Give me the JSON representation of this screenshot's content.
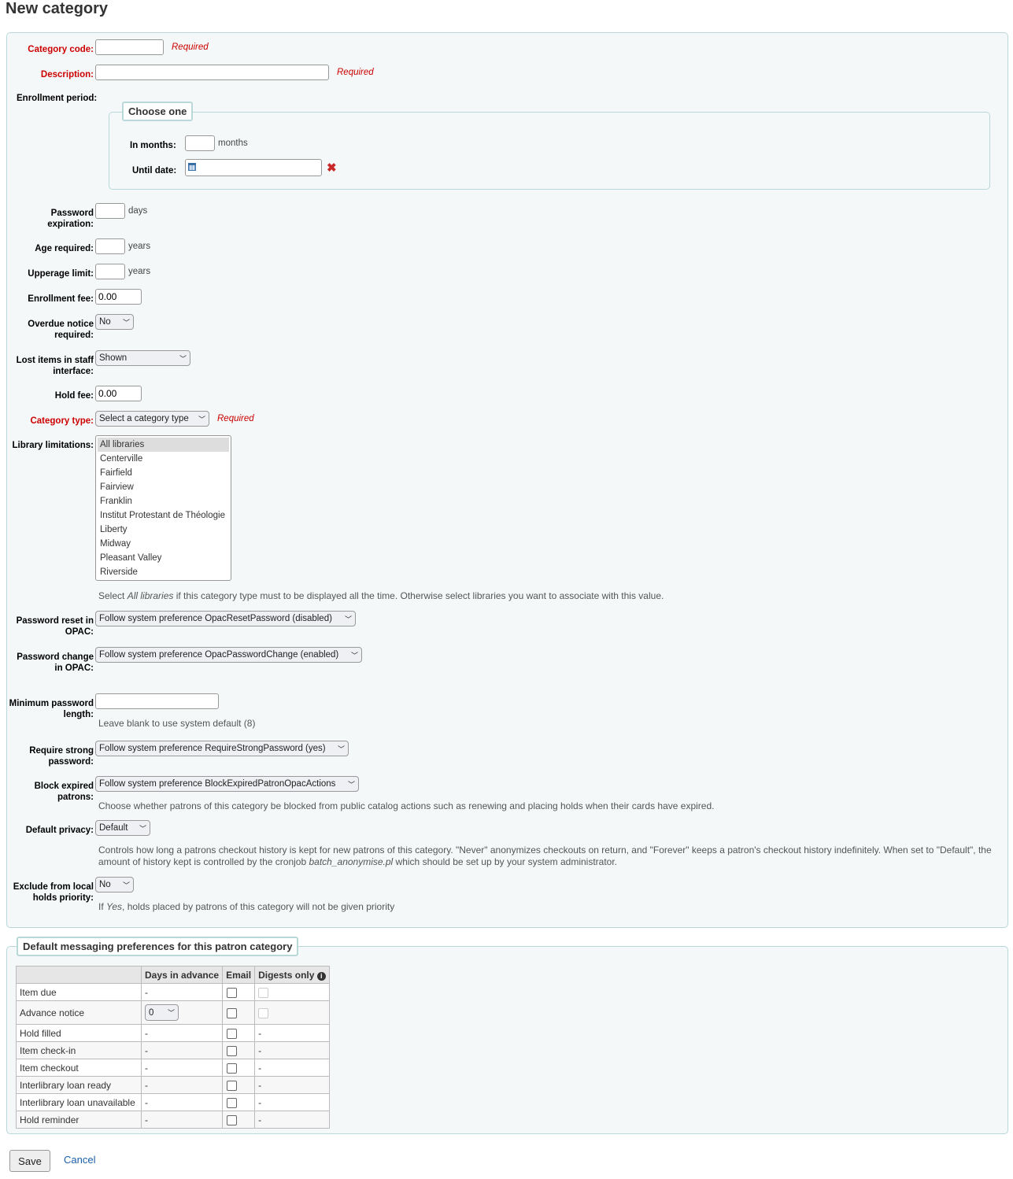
{
  "page_title": "New category",
  "form": {
    "category_code": {
      "label": "Category code:",
      "value": "",
      "required": "Required"
    },
    "description": {
      "label": "Description:",
      "value": "",
      "required": "Required"
    },
    "enrollment_period": {
      "label": "Enrollment period:",
      "legend": "Choose one",
      "in_months_label": "In months:",
      "in_months_unit": "months",
      "until_date_label": "Until date:",
      "calendar_icon": "calendar-icon",
      "clear_icon": "close-x-icon"
    },
    "password_expiration": {
      "label": "Password expiration:",
      "unit": "days"
    },
    "age_required": {
      "label": "Age required:",
      "unit": "years"
    },
    "upperage_limit": {
      "label": "Upperage limit:",
      "unit": "years"
    },
    "enrollment_fee": {
      "label": "Enrollment fee:",
      "value": "0.00"
    },
    "overdue_notice": {
      "label": "Overdue notice required:",
      "value": "No"
    },
    "lost_items": {
      "label": "Lost items in staff interface:",
      "value": "Shown"
    },
    "hold_fee": {
      "label": "Hold fee:",
      "value": "0.00"
    },
    "category_type": {
      "label": "Category type:",
      "value": "Select a category type",
      "required": "Required"
    },
    "library_limitations": {
      "label": "Library limitations:",
      "options": [
        "All libraries",
        "Centerville",
        "Fairfield",
        "Fairview",
        "Franklin",
        "Institut Protestant de Théologie",
        "Liberty",
        "Midway",
        "Pleasant Valley",
        "Riverside"
      ],
      "selected": "All libraries",
      "hint_pre": "Select ",
      "hint_em": "All libraries",
      "hint_post": " if this category type must to be displayed all the time. Otherwise select libraries you want to associate with this value."
    },
    "password_reset": {
      "label": "Password reset in OPAC:",
      "value": "Follow system preference OpacResetPassword (disabled)"
    },
    "password_change": {
      "label": "Password change in OPAC:",
      "value": "Follow system preference OpacPasswordChange (enabled)"
    },
    "min_password_length": {
      "label": "Minimum password length:",
      "value": "",
      "hint": "Leave blank to use system default (8)"
    },
    "require_strong": {
      "label": "Require strong password:",
      "value": "Follow system preference RequireStrongPassword (yes)"
    },
    "block_expired": {
      "label": "Block expired patrons:",
      "value": "Follow system preference BlockExpiredPatronOpacActions",
      "hint": "Choose whether patrons of this category be blocked from public catalog actions such as renewing and placing holds when their cards have expired."
    },
    "default_privacy": {
      "label": "Default privacy:",
      "value": "Default",
      "hint_pre": "Controls how long a patrons checkout history is kept for new patrons of this category. \"Never\" anonymizes checkouts on return, and \"Forever\" keeps a patron's checkout history indefinitely. When set to \"Default\", the amount of history kept is controlled by the cronjob ",
      "hint_em": "batch_anonymise.pl",
      "hint_post": " which should be set up by your system administrator."
    },
    "exclude_local_holds": {
      "label": "Exclude from local holds priority:",
      "value": "No",
      "hint_pre": "If ",
      "hint_em": "Yes",
      "hint_post": ", holds placed by patrons of this category will not be given priority"
    }
  },
  "messaging": {
    "legend": "Default messaging preferences for this patron category",
    "headers": [
      "",
      "Days in advance",
      "Email",
      "Digests only"
    ],
    "info_icon": "info-circle-icon",
    "rows": [
      {
        "name": "Item due",
        "days": "-",
        "digest": "checkbox-disabled"
      },
      {
        "name": "Advance notice",
        "days": "0",
        "digest": "checkbox-disabled"
      },
      {
        "name": "Hold filled",
        "days": "-",
        "digest": "-"
      },
      {
        "name": "Item check-in",
        "days": "-",
        "digest": "-"
      },
      {
        "name": "Item checkout",
        "days": "-",
        "digest": "-"
      },
      {
        "name": "Interlibrary loan ready",
        "days": "-",
        "digest": "-"
      },
      {
        "name": "Interlibrary loan unavailable",
        "days": "-",
        "digest": "-"
      },
      {
        "name": "Hold reminder",
        "days": "-",
        "digest": "-"
      }
    ]
  },
  "actions": {
    "save": "Save",
    "cancel": "Cancel"
  },
  "colors": {
    "required": "#cc0000",
    "fieldset_bg": "#f4f8f9",
    "fieldset_border": "#b9d8d9",
    "link": "#1a5fa8"
  }
}
